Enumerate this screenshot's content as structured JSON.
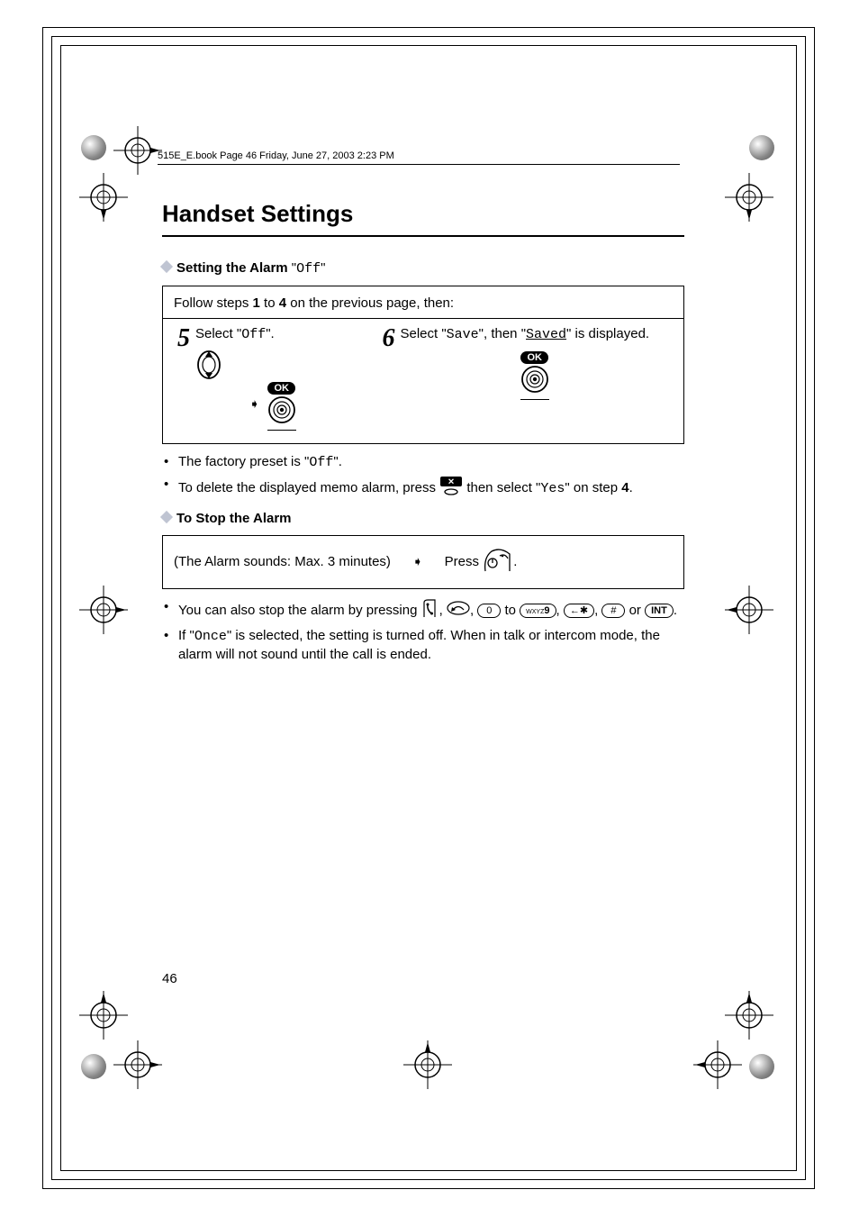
{
  "header_strip": "515E_E.book  Page 46  Friday, June 27, 2003  2:23 PM",
  "title": "Handset Settings",
  "section1": {
    "prefix": "Setting the Alarm ",
    "quoted": "Off"
  },
  "box1_intro": {
    "a": "Follow steps ",
    "b1": "1",
    "mid": " to ",
    "b4": "4",
    "c": " on the previous page, then:"
  },
  "step5": {
    "num": "5",
    "a": "Select \"",
    "mono": "Off",
    "b": "\"."
  },
  "step6": {
    "num": "6",
    "a": "Select \"",
    "m1": "Save",
    "b": "\", then \"",
    "m2": "Saved",
    "c": "\" is displayed."
  },
  "ok": "OK",
  "bullets1": {
    "li1": {
      "a": "The factory preset is \"",
      "m": "Off",
      "b": "\"."
    },
    "li2": {
      "a": "To delete the displayed memo alarm, press ",
      "b": " then select \"",
      "m": "Yes",
      "c": "\" on step ",
      "bold": "4",
      "d": "."
    }
  },
  "section2": "To Stop the Alarm",
  "box2": {
    "left": "(The Alarm sounds: Max. 3 minutes)",
    "press": "Press ",
    "end": "."
  },
  "bullets2": {
    "li1": {
      "a": "You can also stop the alarm by pressing ",
      "comma": ", ",
      "to": " to ",
      "or": " or ",
      "end": "."
    },
    "li2": {
      "a": "If \"",
      "m": "Once",
      "b": "\" is selected, the setting is turned off. When in talk or intercom mode, the alarm will not sound until the call is ended."
    }
  },
  "keys": {
    "zero": "0",
    "nine9": "9",
    "star": "✱",
    "hash": "#",
    "int": "INT",
    "wxyz": "WXYZ"
  },
  "page_number": "46"
}
